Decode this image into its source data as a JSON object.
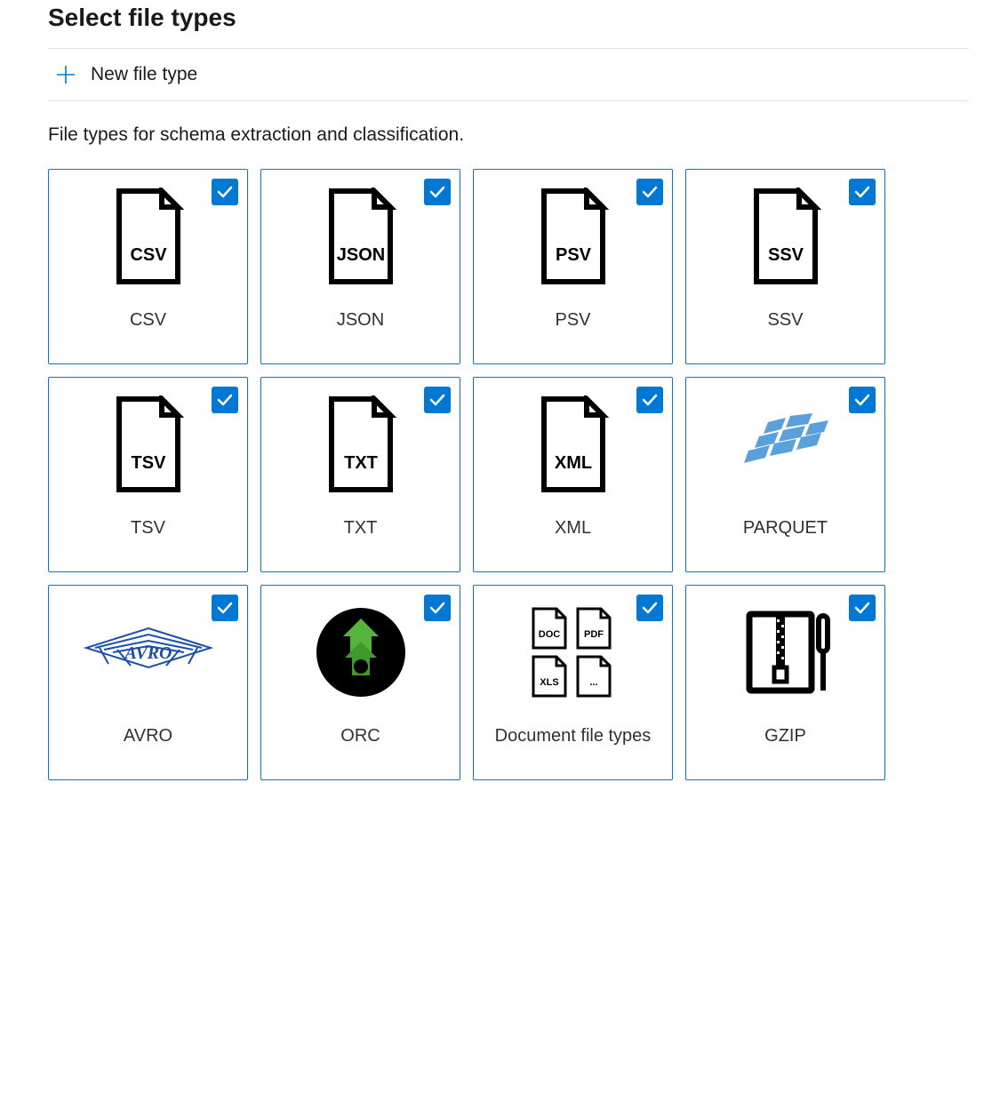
{
  "header": {
    "title": "Select file types",
    "new_file_type_label": "New file type"
  },
  "description": "File types for schema extraction and classification.",
  "file_types": [
    {
      "label": "CSV",
      "icon_type": "doc",
      "icon_text": "CSV",
      "checked": true
    },
    {
      "label": "JSON",
      "icon_type": "doc",
      "icon_text": "JSON",
      "checked": true
    },
    {
      "label": "PSV",
      "icon_type": "doc",
      "icon_text": "PSV",
      "checked": true
    },
    {
      "label": "SSV",
      "icon_type": "doc",
      "icon_text": "SSV",
      "checked": true
    },
    {
      "label": "TSV",
      "icon_type": "doc",
      "icon_text": "TSV",
      "checked": true
    },
    {
      "label": "TXT",
      "icon_type": "doc",
      "icon_text": "TXT",
      "checked": true
    },
    {
      "label": "XML",
      "icon_type": "doc",
      "icon_text": "XML",
      "checked": true
    },
    {
      "label": "PARQUET",
      "icon_type": "parquet",
      "icon_text": "",
      "checked": true
    },
    {
      "label": "AVRO",
      "icon_type": "avro",
      "icon_text": "",
      "checked": true
    },
    {
      "label": "ORC",
      "icon_type": "orc",
      "icon_text": "",
      "checked": true
    },
    {
      "label": "Document file types",
      "icon_type": "doc_multi",
      "icon_text": "",
      "checked": true
    },
    {
      "label": "GZIP",
      "icon_type": "gzip",
      "icon_text": "",
      "checked": true
    }
  ]
}
